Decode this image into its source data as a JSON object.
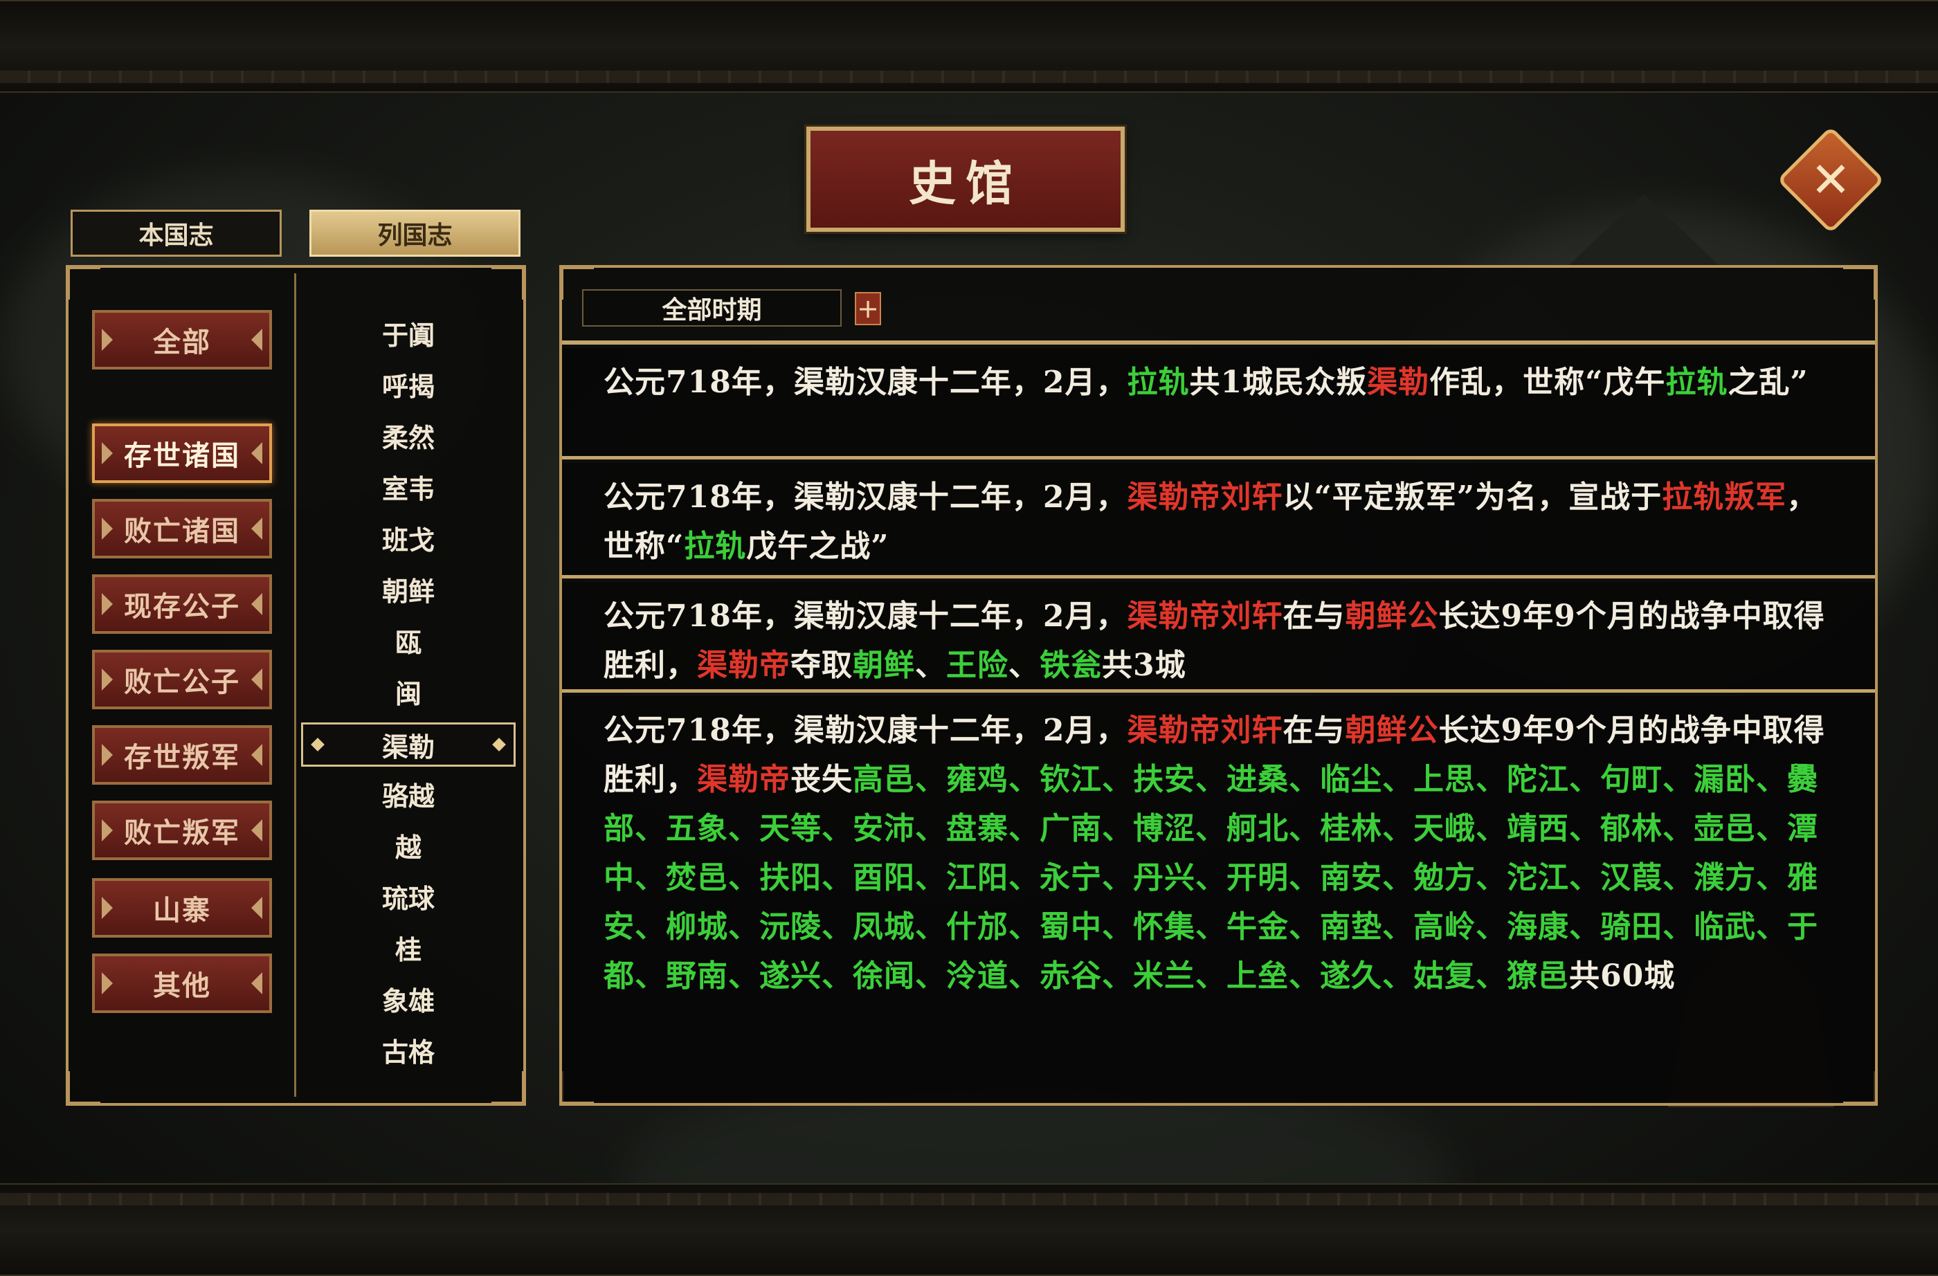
{
  "header": {
    "title": "史馆"
  },
  "tabs": [
    {
      "label": "本国志",
      "active": false
    },
    {
      "label": "列国志",
      "active": true
    }
  ],
  "categories": [
    {
      "label": "全部",
      "selected": false
    },
    {
      "label": "存世诸国",
      "selected": true
    },
    {
      "label": "败亡诸国",
      "selected": false
    },
    {
      "label": "现存公子",
      "selected": false
    },
    {
      "label": "败亡公子",
      "selected": false
    },
    {
      "label": "存世叛军",
      "selected": false
    },
    {
      "label": "败亡叛军",
      "selected": false
    },
    {
      "label": "山寨",
      "selected": false
    },
    {
      "label": "其他",
      "selected": false
    }
  ],
  "countries": [
    "于阗",
    "呼揭",
    "柔然",
    "室韦",
    "班戈",
    "朝鲜",
    "瓯",
    "闽",
    "渠勒",
    "骆越",
    "越",
    "琉球",
    "桂",
    "象雄",
    "古格"
  ],
  "selected_country": "渠勒",
  "filter": {
    "period_label": "全部时期",
    "add_symbol": "+"
  },
  "colors": {
    "red": "#e0362b",
    "green": "#3ccf3a",
    "gold": "#c4a56a",
    "text": "#f2ecdf"
  },
  "entries": [
    {
      "segments": [
        {
          "t": "公元718年，渠勒汉康十二年，2月，",
          "c": "w"
        },
        {
          "t": "拉轨",
          "c": "g"
        },
        {
          "t": "共1城民众叛",
          "c": "w"
        },
        {
          "t": "渠勒",
          "c": "r"
        },
        {
          "t": "作乱，世称“戊午",
          "c": "w"
        },
        {
          "t": "拉轨",
          "c": "g"
        },
        {
          "t": "之乱”",
          "c": "w"
        }
      ]
    },
    {
      "segments": [
        {
          "t": "公元718年，渠勒汉康十二年，2月，",
          "c": "w"
        },
        {
          "t": "渠勒帝刘轩",
          "c": "r"
        },
        {
          "t": "以“平定叛军”为名，宣战于",
          "c": "w"
        },
        {
          "t": "拉轨叛军",
          "c": "r"
        },
        {
          "t": "，世称“",
          "c": "w"
        },
        {
          "t": "拉轨",
          "c": "g"
        },
        {
          "t": "戊午之战”",
          "c": "w"
        }
      ]
    },
    {
      "segments": [
        {
          "t": "公元718年，渠勒汉康十二年，2月，",
          "c": "w"
        },
        {
          "t": "渠勒帝刘轩",
          "c": "r"
        },
        {
          "t": "在与",
          "c": "w"
        },
        {
          "t": "朝鲜公",
          "c": "r"
        },
        {
          "t": "长达9年9个月的战争中取得胜利，",
          "c": "w"
        },
        {
          "t": "渠勒帝",
          "c": "r"
        },
        {
          "t": "夺取",
          "c": "w"
        },
        {
          "t": "朝鲜",
          "c": "g"
        },
        {
          "t": "、",
          "c": "w"
        },
        {
          "t": "王险",
          "c": "g"
        },
        {
          "t": "、",
          "c": "w"
        },
        {
          "t": "铁瓮",
          "c": "g"
        },
        {
          "t": "共3城",
          "c": "w"
        }
      ]
    },
    {
      "segments": [
        {
          "t": "公元718年，渠勒汉康十二年，2月，",
          "c": "w"
        },
        {
          "t": "渠勒帝刘轩",
          "c": "r"
        },
        {
          "t": "在与",
          "c": "w"
        },
        {
          "t": "朝鲜公",
          "c": "r"
        },
        {
          "t": "长达9年9个月的战争中取得胜利，",
          "c": "w"
        },
        {
          "t": "渠勒帝",
          "c": "r"
        },
        {
          "t": "丧失",
          "c": "w"
        },
        {
          "t": "高邑、雍鸡、钦江、扶安、进桑、临尘、上思、陀江、句町、漏卧、爨部、五象、天等、安沛、盘寨、广南、博涩、舸北、桂林、天峨、靖西、郁林、壶邑、潭中、焚邑、扶阳、酉阳、江阳、永宁、丹兴、开明、南安、勉方、沱江、汉葭、濮方、雅安、柳城、沅陵、凤城、什邡、蜀中、怀集、牛金、南垫、高岭、海康、骑田、临武、于都、野南、遂兴、徐闻、泠道、赤谷、米兰、上垒、遂久、姑复、獠邑",
          "c": "g"
        },
        {
          "t": "共60城",
          "c": "w"
        }
      ]
    }
  ]
}
